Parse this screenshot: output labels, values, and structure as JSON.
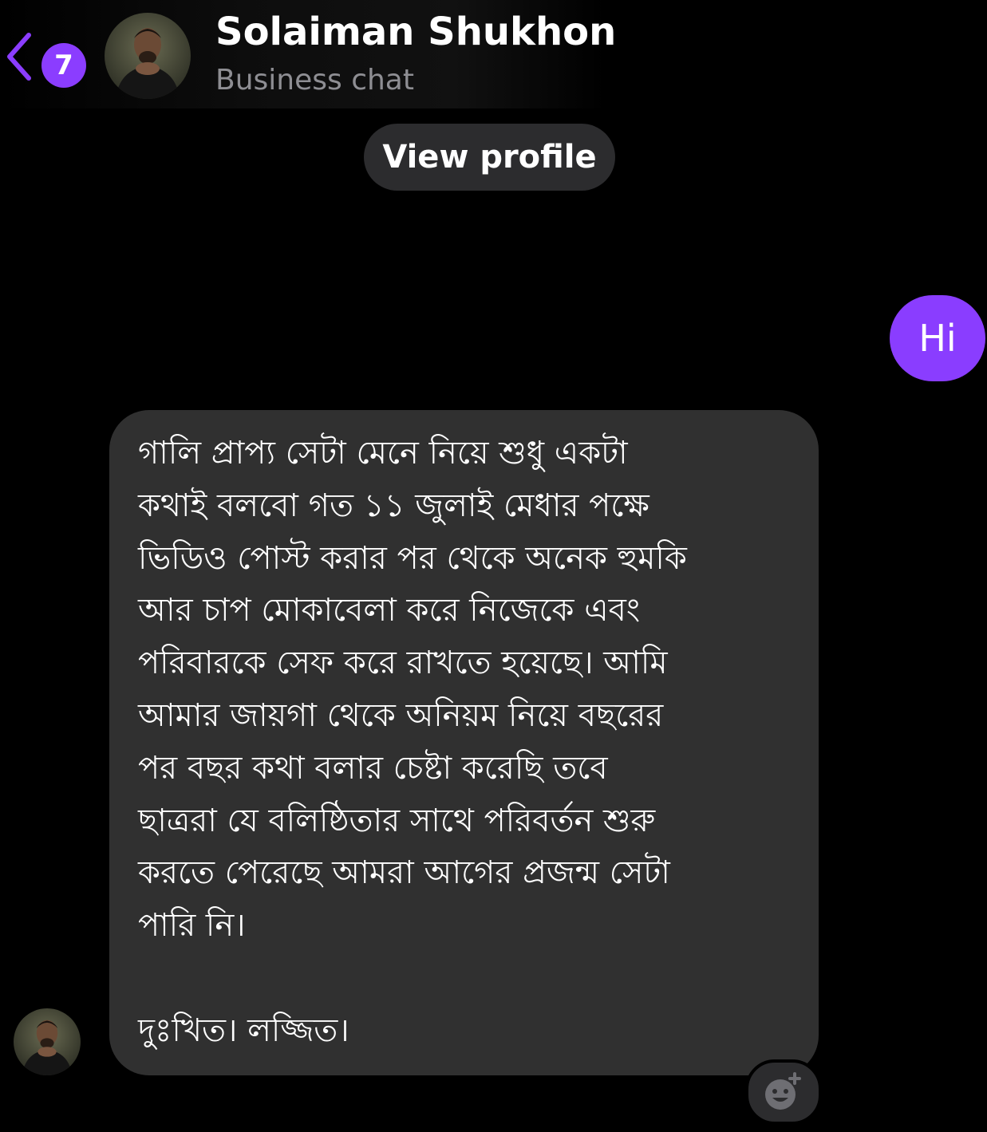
{
  "header": {
    "back": {
      "badge_count": "7",
      "icon": "chevron-left-icon",
      "accent_color": "#8b3dff"
    },
    "avatar": "profile-photo",
    "contact_name": "Solaiman Shukhon",
    "subtitle": "Business chat"
  },
  "view_profile_label": "View profile",
  "messages": {
    "sent": {
      "text": "Hi",
      "bubble_color": "#8a3dff"
    },
    "received": {
      "bubble_color": "#303030",
      "avatar": "profile-photo",
      "lines": [
        "গালি প্রাপ্য সেটা মেনে নিয়ে শুধু একটা",
        "কথাই বলবো গত ১১ জুলাই মেধার পক্ষে",
        "ভিডিও পোস্ট করার পর থেকে অনেক হুমকি",
        "আর চাপ মোকাবেলা করে নিজেকে এবং",
        "পরিবারকে সেফ  করে রাখতে হয়েছে। আমি",
        "আমার জায়গা থেকে অনিয়ম নিয়ে বছরের",
        "পর বছর কথা বলার চেষ্টা করেছি তবে",
        "ছাত্ররা যে বলিষ্ঠিতার সাথে পরিবর্তন শুরু",
        "করতে পেরেছে আমরা আগের প্রজন্ম সেটা",
        "পারি নি।"
      ],
      "closing": "দুঃখিত। লজ্জিত।"
    }
  },
  "reaction": {
    "icon": "add-reaction-icon"
  }
}
